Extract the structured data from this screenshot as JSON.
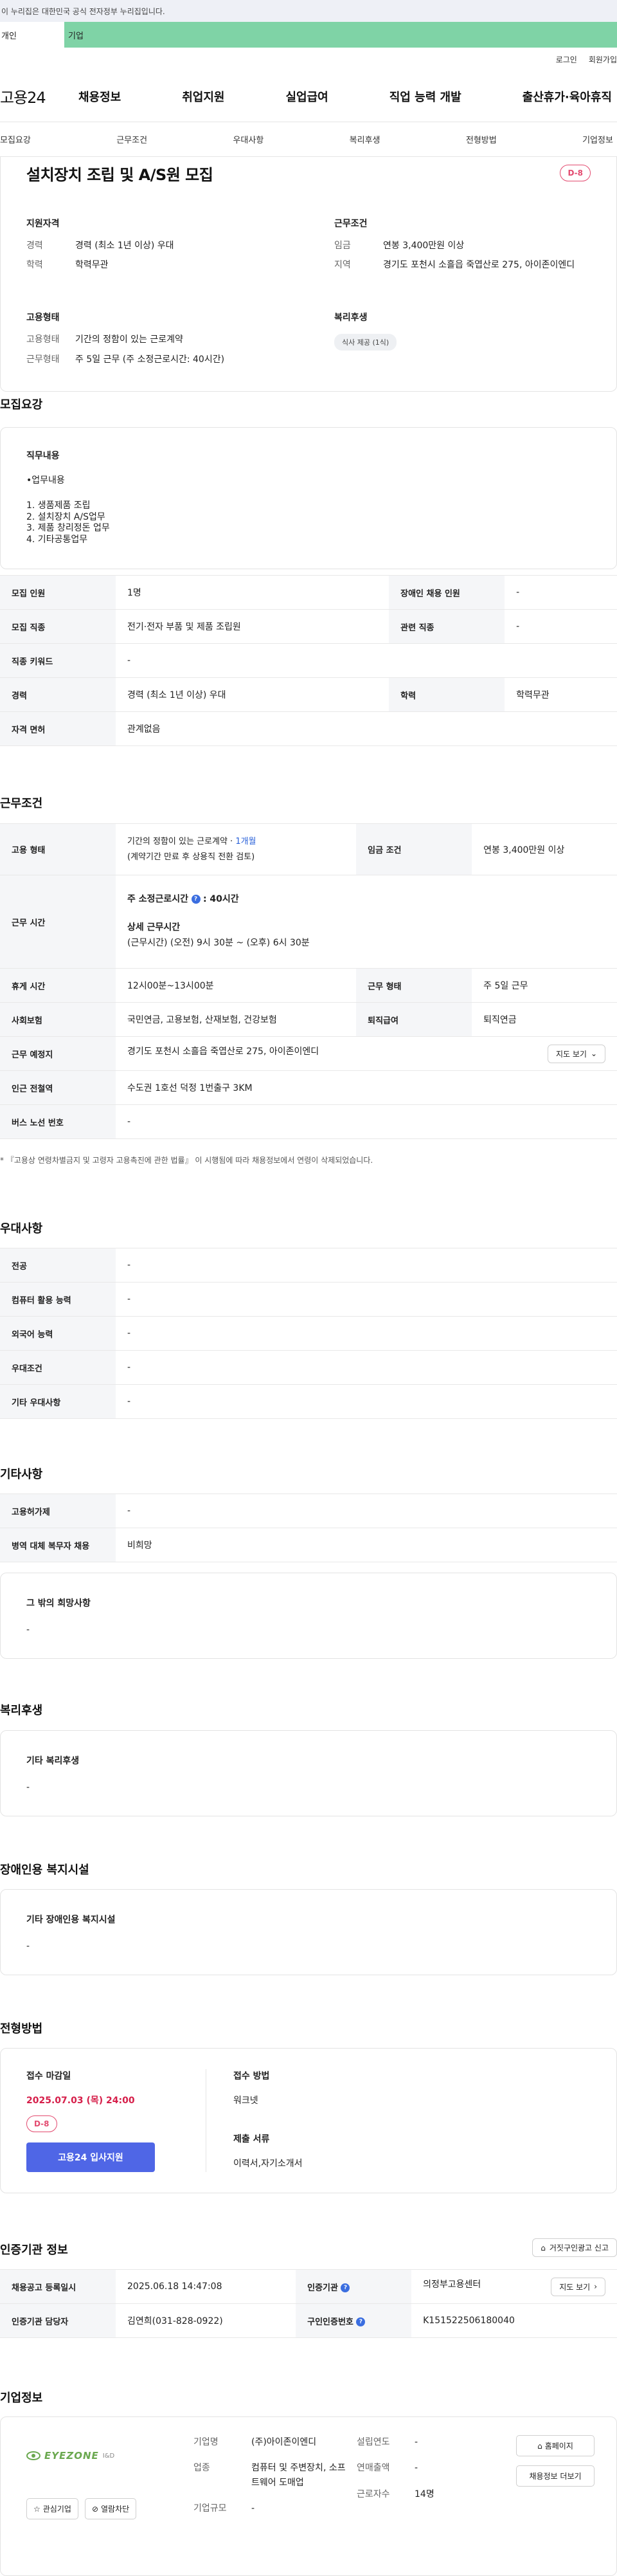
{
  "gov_banner": "이 누리집은 대한민국 공식 전자정부 누리집입니다.",
  "user_tabs": {
    "personal": "개인",
    "company": "기업"
  },
  "util": {
    "login": "로그인",
    "join": "회원가입"
  },
  "logo": "고용24",
  "gnb": [
    "채용정보",
    "취업지원",
    "실업급여",
    "직업 능력 개발",
    "출산휴가·육아휴직"
  ],
  "lnb": [
    "모집요강",
    "근무조건",
    "우대사항",
    "복리후생",
    "전형방법",
    "기업정보"
  ],
  "summary": {
    "title": "설치장치 조립 및 A/S원 모집",
    "dday": "D-8",
    "qualification": {
      "heading": "지원자격",
      "career_k": "경력",
      "career_v": "경력 (최소 1년 이상) 우대",
      "edu_k": "학력",
      "edu_v": "학력무관"
    },
    "conditions": {
      "heading": "근무조건",
      "wage_k": "임금",
      "wage_v": "연봉 3,400만원 이상",
      "region_k": "지역",
      "region_v": "경기도 포천시 소흘읍 죽엽산로 275, 아이존이엔디"
    },
    "employment": {
      "heading": "고용형태",
      "type_k": "고용형태",
      "type_v": "기간의 정함이 있는 근로계약",
      "work_k": "근무형태",
      "work_v": "주 5일 근무 (주 소정근로시간: 40시간)"
    },
    "welfare": {
      "heading": "복리후생",
      "chip": "식사 제공 (1식)"
    }
  },
  "recruit": {
    "heading": "모집요강",
    "duty_label": "직무내용",
    "duty_lines": [
      "•업무내용",
      "",
      "1. 생품제품 조립",
      "2. 설치장치 A/S업무",
      "3. 제품 창리정돈 업무",
      "4. 기타공통업무"
    ],
    "rows": [
      {
        "k1": "모집 인원",
        "v1": "1명",
        "k2": "장애인 채용 인원",
        "v2": "-"
      },
      {
        "k1": "모집 직종",
        "v1": "전기·전자 부품 및 제품 조립원",
        "k2": "관련 직종",
        "v2": "-"
      },
      {
        "k1": "직종 키워드",
        "v1": "-"
      },
      {
        "k1": "경력",
        "v1": "경력 (최소 1년 이상) 우대",
        "k2": "학력",
        "v2": "학력무관"
      },
      {
        "k1": "자격 면허",
        "v1": "관계없음"
      }
    ]
  },
  "work": {
    "heading": "근무조건",
    "emp_type_k": "고용 형태",
    "emp_type_v1": "기간의 정함이 있는 근로계약 · ",
    "emp_type_link": "1개월",
    "emp_type_v2": "(계약기간 만료 후 상용직 전환 검토)",
    "wage_k": "임금 조건",
    "wage_v": "연봉 3,400만원 이상",
    "hours_k": "근무 시간",
    "hours_main_label": "주 소정근로시간",
    "hours_main_value": ": 40시간",
    "hours_detail_label": "상세 근무시간",
    "hours_detail_value": "(근무시간) (오전) 9시 30분 ~ (오후) 6시 30분",
    "break_k": "휴게 시간",
    "break_v": "12시00분~13시00분",
    "form_k": "근무 형태",
    "form_v": "주 5일 근무",
    "insurance_k": "사회보험",
    "insurance_v": "국민연금, 고용보험, 산재보험, 건강보험",
    "retire_k": "퇴직급여",
    "retire_v": "퇴직연금",
    "place_k": "근무 예정지",
    "place_v": "경기도 포천시 소흘읍 죽엽산로 275, 아이존이엔디",
    "map_btn": "지도 보기",
    "subway_k": "인근 전철역",
    "subway_v": "수도권 1호선 덕정 1번출구 3KM",
    "bus_k": "버스 노선 번호",
    "bus_v": "-",
    "note": "* 『고용상 연령차별금지 및 고령자 고용촉진에 관한 법률』 이 시행됨에 따라 채용정보에서 연령이 삭제되었습니다."
  },
  "preference": {
    "heading": "우대사항",
    "rows": [
      {
        "k": "전공",
        "v": "-"
      },
      {
        "k": "컴퓨터 활용 능력",
        "v": "-"
      },
      {
        "k": "외국어 능력",
        "v": "-"
      },
      {
        "k": "우대조건",
        "v": "-"
      },
      {
        "k": "기타 우대사항",
        "v": "-"
      }
    ]
  },
  "etc": {
    "heading": "기타사항",
    "rows": [
      {
        "k": "고용허가제",
        "v": "-"
      },
      {
        "k": "병역 대체 복무자 채용",
        "v": "비희망"
      }
    ],
    "other_label": "그 밖의 희망사항",
    "other_value": "-"
  },
  "welfare": {
    "heading": "복리후생",
    "label": "기타 복리후생",
    "value": "-"
  },
  "disability": {
    "heading": "장애인용 복지시설",
    "label": "기타 장애인용 복지시설",
    "value": "-"
  },
  "selection": {
    "heading": "전형방법",
    "deadline_label": "접수 마감일",
    "deadline": "2025.07.03 (목) 24:00",
    "dday": "D-8",
    "apply_btn": "고용24 입사지원",
    "method_label": "접수 방법",
    "method": "워크넷",
    "docs_label": "제출 서류",
    "docs": "이력서,자기소개서"
  },
  "agency": {
    "heading": "인증기관 정보",
    "report_btn": "거짓구인광고 신고",
    "reg_date_k": "채용공고 등록일시",
    "reg_date_v": "2025.06.18 14:47:08",
    "agency_k": "인증기관",
    "agency_v": "의정부고용센터",
    "map_btn": "지도 보기",
    "manager_k": "인증기관 담당자",
    "manager_v": "김연희(031-828-0922)",
    "cert_k": "구인인증번호",
    "cert_v": "K151522506180040"
  },
  "company": {
    "heading": "기업정보",
    "logo_text": "EYEZONE",
    "logo_sub": "I&D",
    "interest_btn": "관심기업",
    "block_btn": "열람차단",
    "name_k": "기업명",
    "name_v": "(주)아이존이엔디",
    "industry_k": "업종",
    "industry_v": "컴퓨터 및 주변장치, 소프트웨어 도매업",
    "size_k": "기업규모",
    "size_v": "-",
    "founded_k": "설립연도",
    "founded_v": "-",
    "sales_k": "연매출액",
    "sales_v": "-",
    "employees_k": "근로자수",
    "employees_v": "14명",
    "homepage_btn": "홈페이지",
    "jobs_btn": "채용정보 더보기"
  }
}
